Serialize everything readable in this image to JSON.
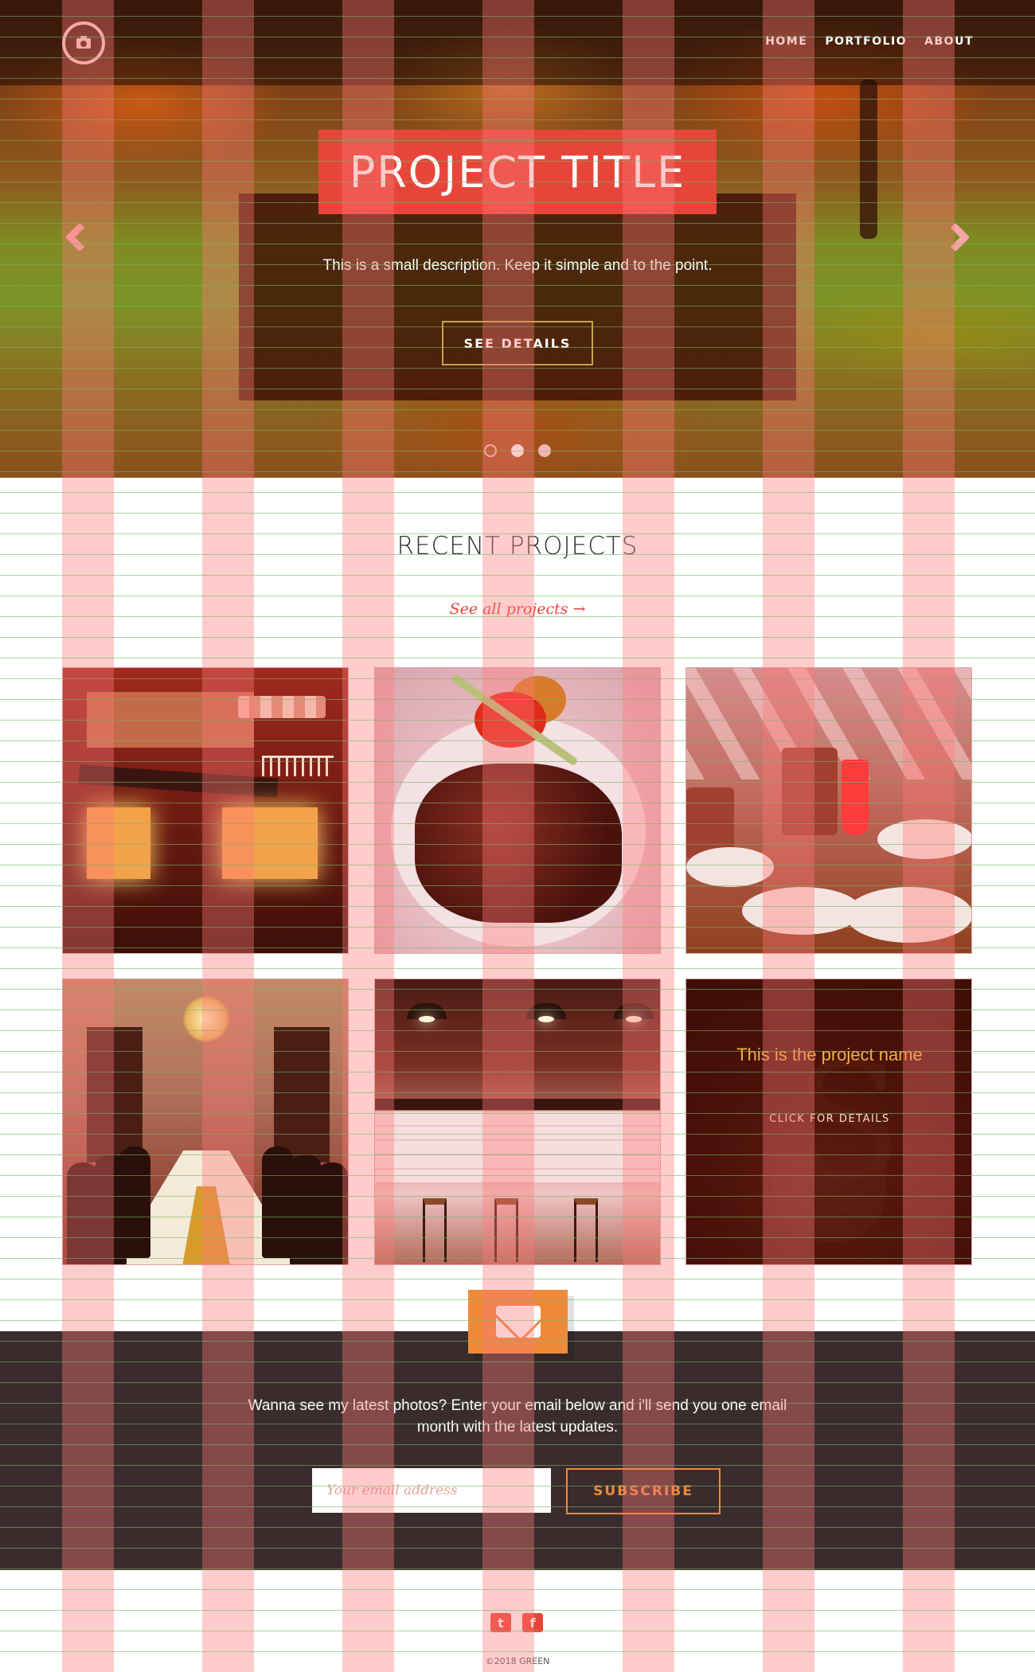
{
  "nav": {
    "logo_icon": "camera-icon",
    "links": [
      {
        "label": "HOME"
      },
      {
        "label": "PORTFOLIO"
      },
      {
        "label": "ABOUT"
      }
    ]
  },
  "hero": {
    "title": "PROJECT TITLE",
    "description": "This is a small description. Keep it simple and to the point.",
    "button_label": "SEE DETAILS",
    "prev_icon": "chevron-left-icon",
    "next_icon": "chevron-right-icon",
    "slides_count": 3,
    "active_slide": 2
  },
  "projects": {
    "title": "RECENT PROJECTS",
    "see_all": "See all projects →",
    "tiles": [
      {
        "image": "miniature-shop-photo"
      },
      {
        "image": "steak-dish-photo"
      },
      {
        "image": "restaurant-drinks-photo"
      },
      {
        "image": "banquet-hall-photo"
      },
      {
        "image": "cafe-interior-photo"
      },
      {
        "image": "coffee-shop-photo",
        "name": "This is the project name",
        "cta": "CLICK FOR DETAILS"
      }
    ]
  },
  "subscribe": {
    "icon": "envelope-icon",
    "text": "Wanna see my latest photos? Enter your email below and i'll send you one email month with the latest updates.",
    "email_placeholder": "Your email address",
    "button_label": "SUBSCRIBE"
  },
  "footer": {
    "social": [
      {
        "icon": "twitter-icon",
        "glyph": "t"
      },
      {
        "icon": "facebook-icon",
        "glyph": "f"
      }
    ],
    "copyright": "©2018 GREEN"
  },
  "colors": {
    "accent_red": "#e8453a",
    "accent_orange": "#ee8a3a",
    "title_gold": "#f1b040",
    "dark_band": "#3a2c2c"
  }
}
